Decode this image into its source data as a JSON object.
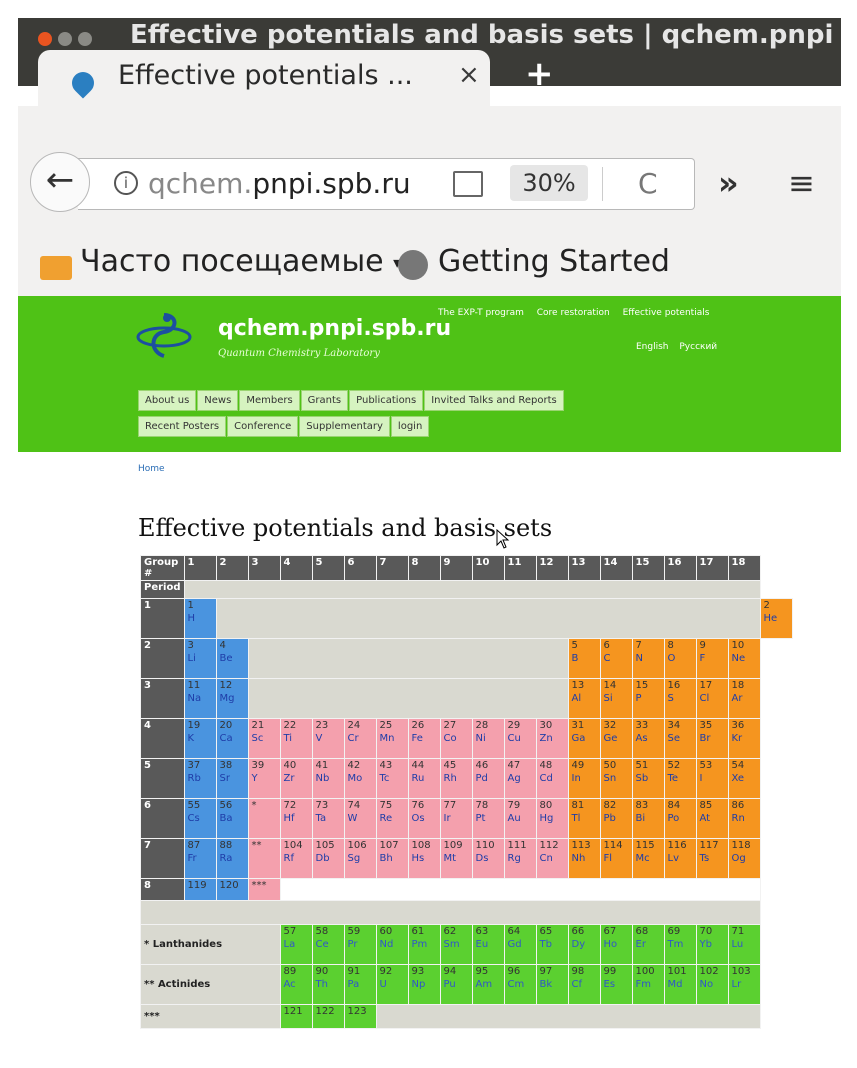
{
  "window": {
    "title": "Effective potentials and basis sets | qchem.pnpi"
  },
  "tab": {
    "title": "Effective potentials ...",
    "close": "×",
    "new_tab": "+"
  },
  "navbar": {
    "back": "←",
    "info": "i",
    "url_prefix": "qchem.",
    "url_domain": "pnpi.spb.ru",
    "zoom": "30%",
    "reload": "C",
    "overflow": "»",
    "menu": "≡"
  },
  "bookmarks": {
    "often_visited": "Часто посещаемые",
    "caret": "▾",
    "getting_started": "Getting Started"
  },
  "site": {
    "name": "qchem.pnpi.spb.ru",
    "slogan": "Quantum Chemistry Laboratory",
    "top_links": [
      "The EXP-T program",
      "Core restoration",
      "Effective potentials"
    ],
    "languages": [
      "English",
      "Русский"
    ],
    "menu_row1": [
      "About us",
      "News",
      "Members",
      "Grants",
      "Publications",
      "Invited Talks and Reports"
    ],
    "menu_row2": [
      "Recent Posters",
      "Conference",
      "Supplementary",
      "login"
    ],
    "breadcrumb": "Home",
    "page_title": "Effective potentials and basis sets"
  },
  "table": {
    "group_header": "Group #",
    "groups": [
      "1",
      "2",
      "3",
      "4",
      "5",
      "6",
      "7",
      "8",
      "9",
      "10",
      "11",
      "12",
      "13",
      "14",
      "15",
      "16",
      "17",
      "18"
    ],
    "period_header": "Period",
    "periods": [
      "1",
      "2",
      "3",
      "4",
      "5",
      "6",
      "7",
      "8"
    ],
    "elements": {
      "1": [
        [
          "1",
          "H",
          "blue"
        ],
        "gap17",
        [
          "2",
          "He",
          "orange"
        ]
      ],
      "2": [
        [
          "3",
          "Li",
          "blue"
        ],
        [
          "4",
          "Be",
          "blue"
        ],
        "gap10",
        [
          "5",
          "B",
          "orange"
        ],
        [
          "6",
          "C",
          "orange"
        ],
        [
          "7",
          "N",
          "orange"
        ],
        [
          "8",
          "O",
          "orange"
        ],
        [
          "9",
          "F",
          "orange"
        ],
        [
          "10",
          "Ne",
          "orange"
        ]
      ],
      "3": [
        [
          "11",
          "Na",
          "blue"
        ],
        [
          "12",
          "Mg",
          "blue"
        ],
        "gap10",
        [
          "13",
          "Al",
          "orange"
        ],
        [
          "14",
          "Si",
          "orange"
        ],
        [
          "15",
          "P",
          "orange"
        ],
        [
          "16",
          "S",
          "orange"
        ],
        [
          "17",
          "Cl",
          "orange"
        ],
        [
          "18",
          "Ar",
          "orange"
        ]
      ],
      "4": [
        [
          "19",
          "K",
          "blue"
        ],
        [
          "20",
          "Ca",
          "blue"
        ],
        [
          "21",
          "Sc",
          "pink"
        ],
        [
          "22",
          "Ti",
          "pink"
        ],
        [
          "23",
          "V",
          "pink"
        ],
        [
          "24",
          "Cr",
          "pink"
        ],
        [
          "25",
          "Mn",
          "pink"
        ],
        [
          "26",
          "Fe",
          "pink"
        ],
        [
          "27",
          "Co",
          "pink"
        ],
        [
          "28",
          "Ni",
          "pink"
        ],
        [
          "29",
          "Cu",
          "pink"
        ],
        [
          "30",
          "Zn",
          "pink"
        ],
        [
          "31",
          "Ga",
          "orange"
        ],
        [
          "32",
          "Ge",
          "orange"
        ],
        [
          "33",
          "As",
          "orange"
        ],
        [
          "34",
          "Se",
          "orange"
        ],
        [
          "35",
          "Br",
          "orange"
        ],
        [
          "36",
          "Kr",
          "orange"
        ]
      ],
      "5": [
        [
          "37",
          "Rb",
          "blue"
        ],
        [
          "38",
          "Sr",
          "blue"
        ],
        [
          "39",
          "Y",
          "pink"
        ],
        [
          "40",
          "Zr",
          "pink"
        ],
        [
          "41",
          "Nb",
          "pink"
        ],
        [
          "42",
          "Mo",
          "pink"
        ],
        [
          "43",
          "Tc",
          "pink"
        ],
        [
          "44",
          "Ru",
          "pink"
        ],
        [
          "45",
          "Rh",
          "pink"
        ],
        [
          "46",
          "Pd",
          "pink"
        ],
        [
          "47",
          "Ag",
          "pink"
        ],
        [
          "48",
          "Cd",
          "pink"
        ],
        [
          "49",
          "In",
          "orange"
        ],
        [
          "50",
          "Sn",
          "orange"
        ],
        [
          "51",
          "Sb",
          "orange"
        ],
        [
          "52",
          "Te",
          "orange"
        ],
        [
          "53",
          "I",
          "orange"
        ],
        [
          "54",
          "Xe",
          "orange"
        ]
      ],
      "6": [
        [
          "55",
          "Cs",
          "blue"
        ],
        [
          "56",
          "Ba",
          "blue"
        ],
        [
          "*",
          "",
          "pink"
        ],
        [
          "72",
          "Hf",
          "pink"
        ],
        [
          "73",
          "Ta",
          "pink"
        ],
        [
          "74",
          "W",
          "pink"
        ],
        [
          "75",
          "Re",
          "pink"
        ],
        [
          "76",
          "Os",
          "pink"
        ],
        [
          "77",
          "Ir",
          "pink"
        ],
        [
          "78",
          "Pt",
          "pink"
        ],
        [
          "79",
          "Au",
          "pink"
        ],
        [
          "80",
          "Hg",
          "pink"
        ],
        [
          "81",
          "Tl",
          "orange"
        ],
        [
          "82",
          "Pb",
          "orange"
        ],
        [
          "83",
          "Bi",
          "orange"
        ],
        [
          "84",
          "Po",
          "orange"
        ],
        [
          "85",
          "At",
          "orange"
        ],
        [
          "86",
          "Rn",
          "orange"
        ]
      ],
      "7": [
        [
          "87",
          "Fr",
          "blue"
        ],
        [
          "88",
          "Ra",
          "blue"
        ],
        [
          "**",
          "",
          "pink"
        ],
        [
          "104",
          "Rf",
          "pink"
        ],
        [
          "105",
          "Db",
          "pink"
        ],
        [
          "106",
          "Sg",
          "pink"
        ],
        [
          "107",
          "Bh",
          "pink"
        ],
        [
          "108",
          "Hs",
          "pink"
        ],
        [
          "109",
          "Mt",
          "pink"
        ],
        [
          "110",
          "Ds",
          "pink"
        ],
        [
          "111",
          "Rg",
          "pink"
        ],
        [
          "112",
          "Cn",
          "pink"
        ],
        [
          "113",
          "Nh",
          "orange"
        ],
        [
          "114",
          "Fl",
          "orange"
        ],
        [
          "115",
          "Mc",
          "orange"
        ],
        [
          "116",
          "Lv",
          "orange"
        ],
        [
          "117",
          "Ts",
          "orange"
        ],
        [
          "118",
          "Og",
          "orange"
        ]
      ],
      "8": [
        [
          "119",
          "",
          "blue"
        ],
        [
          "120",
          "",
          "blue"
        ],
        [
          "***",
          "",
          "pink"
        ]
      ]
    },
    "lanthanides_label": "* Lanthanides",
    "lanthanides": [
      [
        "57",
        "La"
      ],
      [
        "58",
        "Ce"
      ],
      [
        "59",
        "Pr"
      ],
      [
        "60",
        "Nd"
      ],
      [
        "61",
        "Pm"
      ],
      [
        "62",
        "Sm"
      ],
      [
        "63",
        "Eu"
      ],
      [
        "64",
        "Gd"
      ],
      [
        "65",
        "Tb"
      ],
      [
        "66",
        "Dy"
      ],
      [
        "67",
        "Ho"
      ],
      [
        "68",
        "Er"
      ],
      [
        "69",
        "Tm"
      ],
      [
        "70",
        "Yb"
      ],
      [
        "71",
        "Lu"
      ]
    ],
    "actinides_label": "** Actinides",
    "actinides": [
      [
        "89",
        "Ac"
      ],
      [
        "90",
        "Th"
      ],
      [
        "91",
        "Pa"
      ],
      [
        "92",
        "U"
      ],
      [
        "93",
        "Np"
      ],
      [
        "94",
        "Pu"
      ],
      [
        "95",
        "Am"
      ],
      [
        "96",
        "Cm"
      ],
      [
        "97",
        "Bk"
      ],
      [
        "98",
        "Cf"
      ],
      [
        "99",
        "Es"
      ],
      [
        "100",
        "Fm"
      ],
      [
        "101",
        "Md"
      ],
      [
        "102",
        "No"
      ],
      [
        "103",
        "Lr"
      ]
    ],
    "superheavy_label": "***",
    "superheavy": [
      [
        "121",
        ""
      ],
      [
        "122",
        ""
      ],
      [
        "123",
        ""
      ]
    ]
  },
  "colors": {
    "blue": "#4a94df",
    "pink": "#f4a0ad",
    "orange": "#f5951f",
    "green": "#5bd030",
    "header_green": "#4fc216",
    "gap": "#d9d9d0"
  }
}
